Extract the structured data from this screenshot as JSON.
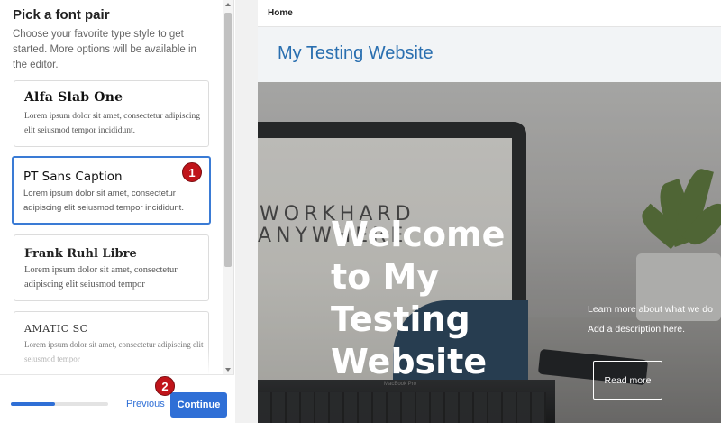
{
  "panel": {
    "title": "Pick a font pair",
    "description": "Choose your favorite type style to get started. More options will be available in the editor."
  },
  "font_pairs": [
    {
      "title": "Alfa Slab One",
      "body": "Lorem ipsum dolor sit amet, consectetur adipiscing elit seiusmod tempor incididunt.",
      "selected": false
    },
    {
      "title": "PT Sans Caption",
      "body": "Lorem ipsum dolor sit amet, consectetur adipiscing elit seiusmod tempor incididunt.",
      "selected": true
    },
    {
      "title": "Frank Ruhl Libre",
      "body": "Lorem ipsum dolor sit amet, consectetur adipiscing elit seiusmod tempor",
      "selected": false
    },
    {
      "title": "AMATIC SC",
      "body": "Lorem ipsum dolor sit amet, consectetur adipiscing elit seiusmod tempor",
      "selected": false
    }
  ],
  "footer": {
    "progress": 0.45,
    "previous_label": "Previous",
    "continue_label": "Continue"
  },
  "markers": {
    "one": "1",
    "two": "2"
  },
  "colors": {
    "accent": "#2f6fd6",
    "marker": "#c0141a",
    "site_title": "#2a6fb0"
  },
  "preview": {
    "nav_home": "Home",
    "site_title": "My Testing Website",
    "hero_title": "Welcome to My Testing Website",
    "hero_desc_line1": "Learn more about what we do",
    "hero_desc_line2": "Add a description here.",
    "read_more_label": "Read more",
    "laptop_wall_line1": "WORKHARD",
    "laptop_wall_line2": "ANYWHERE",
    "laptop_model": "MacBook Pro"
  }
}
